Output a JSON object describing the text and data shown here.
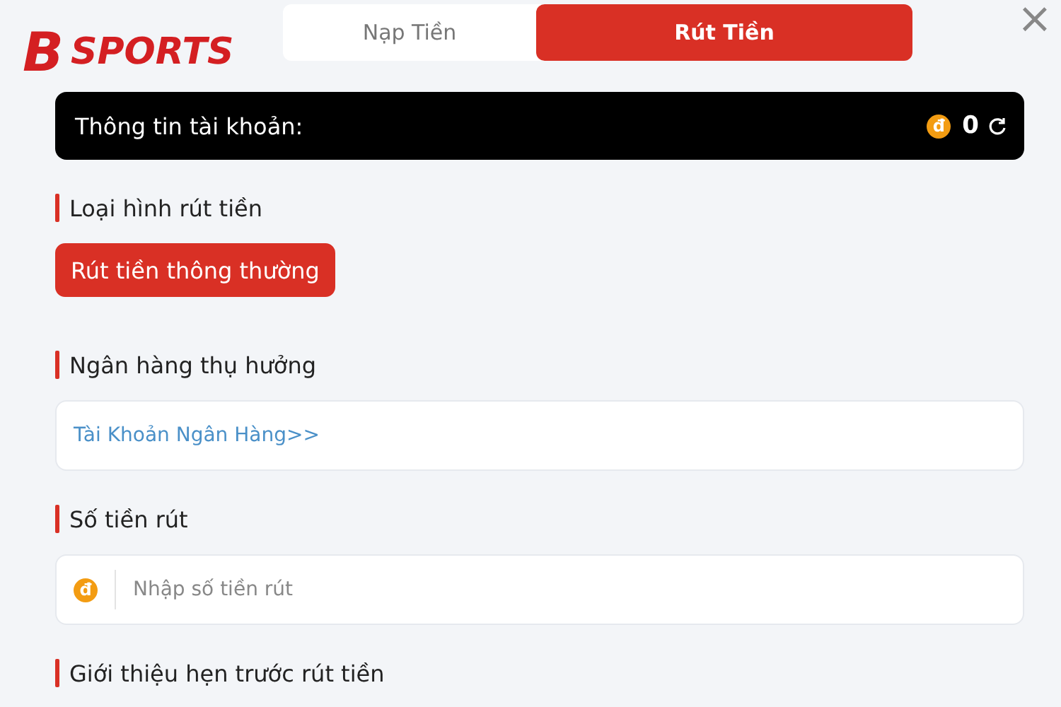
{
  "logo": {
    "mark": "B",
    "text": "SPORTS"
  },
  "tabs": [
    {
      "label": "Nạp Tiền",
      "selected": false
    },
    {
      "label": "Rút Tiền",
      "selected": true
    }
  ],
  "close": "×",
  "account": {
    "label": "Thông tin tài khoản:",
    "currency": "đ",
    "balance": "0"
  },
  "sections": [
    {
      "kind": "options",
      "title": "Loại hình rút tiền",
      "options": [
        {
          "label": "Rút tiền thông thường",
          "selected": true
        }
      ]
    },
    {
      "kind": "link",
      "title": "Ngân hàng thụ hưởng",
      "link": "Tài Khoản Ngân Hàng>>"
    },
    {
      "kind": "amount",
      "title": "Số tiền rút",
      "currency": "đ",
      "placeholder": "Nhập số tiền rút"
    },
    {
      "kind": "heading",
      "title": "Giới thiệu hẹn trước rút tiền"
    }
  ]
}
